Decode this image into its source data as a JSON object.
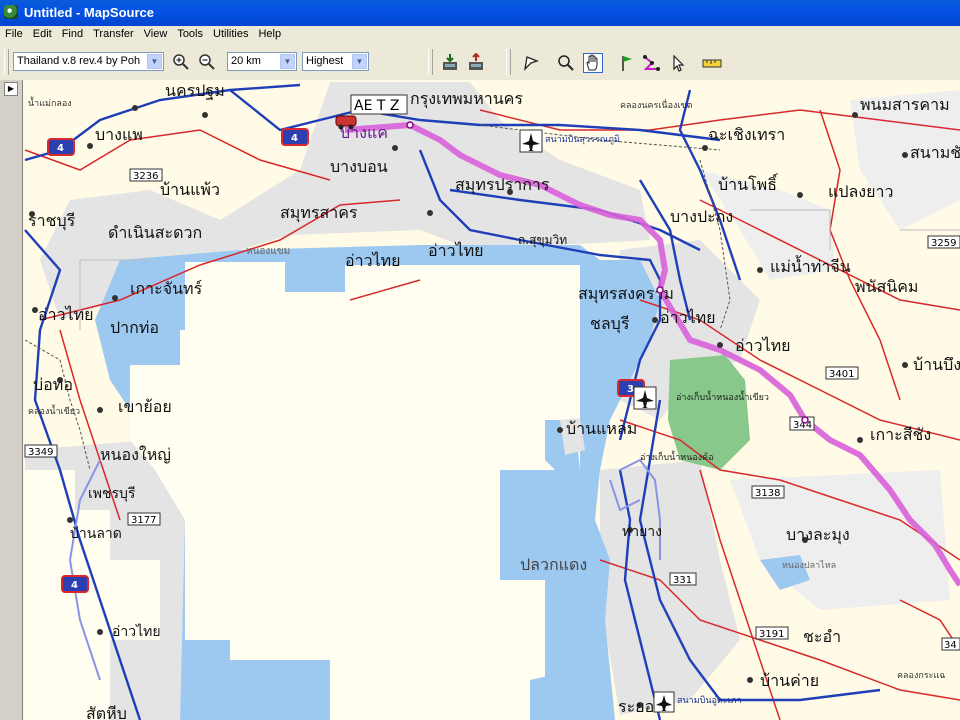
{
  "window": {
    "title": "Untitled - MapSource"
  },
  "menu": [
    "File",
    "Edit",
    "Find",
    "Transfer",
    "View",
    "Tools",
    "Utilities",
    "Help"
  ],
  "toolbar": {
    "map_product": "Thailand v.8 rev.4 by Poh",
    "zoom_scale": "20 km",
    "detail_level": "Highest"
  },
  "map": {
    "overlay_label": "AE T Z",
    "place_labels": [
      {
        "id": "nakhon-pathom",
        "text": "นครปฐม"
      },
      {
        "id": "krung-thep",
        "text": "กรุงเทพมหานคร"
      },
      {
        "id": "phanom-sarakham",
        "text": "พนมสารคาม"
      },
      {
        "id": "ban-phaeo-town",
        "text": "บางแพ"
      },
      {
        "id": "bang-khae",
        "text": "บางแค"
      },
      {
        "id": "nong-khaem",
        "text": "หนองแขม"
      },
      {
        "id": "chachoengsao",
        "text": "ฉะเชิงเทรา"
      },
      {
        "id": "sanam-chai",
        "text": "สนามชัย"
      },
      {
        "id": "bang-bon",
        "text": "บางบอน"
      },
      {
        "id": "samut-prakan",
        "text": "สมุทรปราการ"
      },
      {
        "id": "ban-pho",
        "text": "บ้านโพธิ์"
      },
      {
        "id": "plaeng-yao",
        "text": "แปลงยาว"
      },
      {
        "id": "ban-phaeo",
        "text": "บ้านแพ้ว"
      },
      {
        "id": "ratchaburi",
        "text": "ราชบุรี"
      },
      {
        "id": "damnoen",
        "text": "ดำเนินสะดวก"
      },
      {
        "id": "samut-sakhon",
        "text": "สมุทรสาคร"
      },
      {
        "id": "bang-pakong",
        "text": "บางปะกง"
      },
      {
        "id": "gulf-1",
        "text": "อ่าวไทย"
      },
      {
        "id": "gulf-2",
        "text": "อ่าวไทย"
      },
      {
        "id": "sukhumvit",
        "text": "ถ.สุขุมวิท"
      },
      {
        "id": "mae-nam",
        "text": "แม่น้ำท่าจีน"
      },
      {
        "id": "phanat",
        "text": "พนัสนิคม"
      },
      {
        "id": "ko-chan",
        "text": "เกาะจันทร์"
      },
      {
        "id": "samut-songkhram",
        "text": "สมุทรสงคราม"
      },
      {
        "id": "gulf-3",
        "text": "อ่าวไทย"
      },
      {
        "id": "pak-tho",
        "text": "ปากท่อ"
      },
      {
        "id": "gulf-4",
        "text": "อ่าวไทย"
      },
      {
        "id": "chon-buri",
        "text": "ชลบุรี"
      },
      {
        "id": "gulf-5",
        "text": "อ่าวไทย"
      },
      {
        "id": "ban-bueng",
        "text": "บ้านบึง"
      },
      {
        "id": "bo-thong",
        "text": "บ่อทอ"
      },
      {
        "id": "khao-yoi",
        "text": "เขาย้อย"
      },
      {
        "id": "ban-laem",
        "text": "บ้านแหลม"
      },
      {
        "id": "ko-si-chang",
        "text": "เกาะสีชัง"
      },
      {
        "id": "nong-yai",
        "text": "หนองใหญ่"
      },
      {
        "id": "phetchaburi",
        "text": "เพชรบุรี"
      },
      {
        "id": "ban-lat",
        "text": "บ้านลาด"
      },
      {
        "id": "tha-yang",
        "text": "ท่ายาง"
      },
      {
        "id": "bang-lamung",
        "text": "บางละมุง"
      },
      {
        "id": "pluak-daeng",
        "text": "ปลวกแดง"
      },
      {
        "id": "gulf-6",
        "text": "อ่าวไทย"
      },
      {
        "id": "cha-am",
        "text": "ชะอำ"
      },
      {
        "id": "ban-khai",
        "text": "บ้านค่าย"
      },
      {
        "id": "rayong",
        "text": "ระยอง"
      },
      {
        "id": "sattahip",
        "text": "สัตหีบ"
      },
      {
        "id": "gulf-7",
        "text": "อ่าวไทย"
      }
    ],
    "minor_labels": [
      {
        "id": "mae-klong-top",
        "text": "น้ำแม่กลอง"
      },
      {
        "id": "suvarnabhumi",
        "text": "สนามบินสุวรรณภูมิ"
      },
      {
        "id": "khlong-nakhon",
        "text": "คลองนครเนื่องเขต"
      },
      {
        "id": "khlong-mae-klong",
        "text": "คลองน้ำเขียว"
      },
      {
        "id": "reservoir-1",
        "text": "อ่างเก็บน้ำหนองน้ำเขียว"
      },
      {
        "id": "reservoir-2",
        "text": "อ่างเก็บน้ำหนองค้อ"
      },
      {
        "id": "reservoir-3",
        "text": "หนองปลาไหล"
      },
      {
        "id": "utapao",
        "text": "สนามบินอู่ตะเภา"
      },
      {
        "id": "khlong-krae",
        "text": "คลองกระแฉ"
      }
    ],
    "route_shields": [
      {
        "id": "r3236",
        "text": "3236"
      },
      {
        "id": "r3259",
        "text": "3259"
      },
      {
        "id": "r3401",
        "text": "3401"
      },
      {
        "id": "r344",
        "text": "344"
      },
      {
        "id": "r3349",
        "text": "3349"
      },
      {
        "id": "r3177",
        "text": "3177"
      },
      {
        "id": "r3138",
        "text": "3138"
      },
      {
        "id": "r331",
        "text": "331"
      },
      {
        "id": "r3191",
        "text": "3191"
      },
      {
        "id": "r34",
        "text": "34"
      }
    ],
    "highway_shields": [
      {
        "id": "hw4-a",
        "text": "4"
      },
      {
        "id": "hw4-b",
        "text": "4"
      },
      {
        "id": "hw3",
        "text": "3"
      },
      {
        "id": "hw4-c",
        "text": "4"
      }
    ],
    "colors": {
      "land": "#fffbe6",
      "urban": "#e4e4e4",
      "water": "#9dc8f0",
      "forest": "#88c88a",
      "route": "#d860d8",
      "highway": "#1f3fb8",
      "road": "#d8282c"
    }
  }
}
